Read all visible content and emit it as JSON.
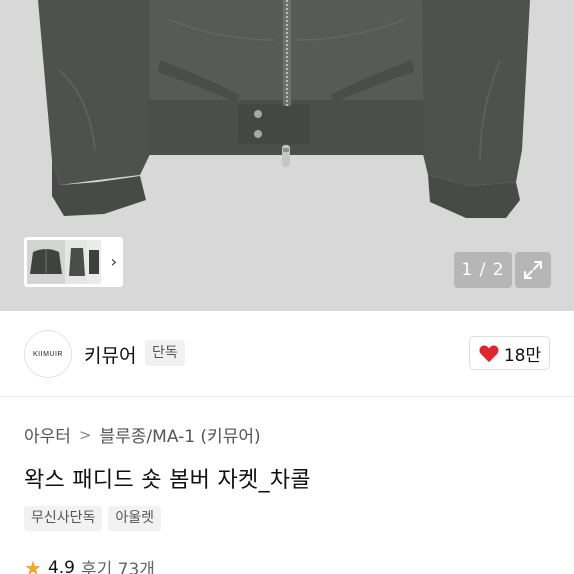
{
  "gallery": {
    "counter": "1 / 2",
    "thumb_arrow": "›",
    "image_name": "charcoal-padded-bomber-jacket"
  },
  "brand": {
    "logo_text": "KIIMUIR",
    "name": "키뮤어",
    "badge": "단독",
    "likes": "18만",
    "like_color": "#e1252d"
  },
  "breadcrumb": {
    "first": "아우터",
    "separator": ">",
    "second": "블루종/MA-1 (키뮤어)"
  },
  "product": {
    "title": "왁스 패디드 숏 봄버 자켓_차콜",
    "tags": [
      "무신사단독",
      "아울렛"
    ]
  },
  "rating": {
    "star_icon": "★",
    "score": "4.9",
    "reviews": "후기 73개"
  }
}
